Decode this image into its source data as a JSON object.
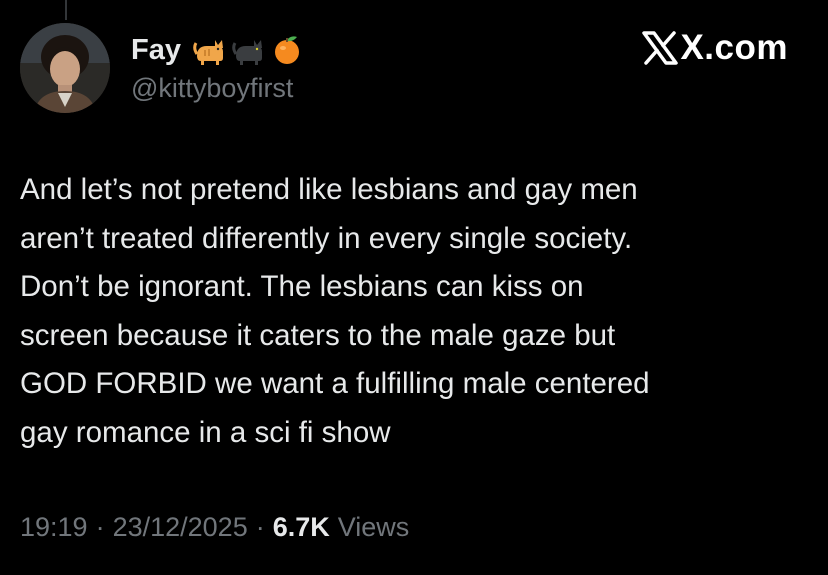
{
  "colors": {
    "background": "#000000",
    "primary_text": "#e7e9ea",
    "secondary_text": "#71767b"
  },
  "author": {
    "display_name": "Fay",
    "handle": "@kittyboyfirst",
    "name_emojis": [
      "orange-cat-emoji",
      "black-cat-emoji",
      "tangerine-emoji"
    ]
  },
  "brand": {
    "label": "X.com",
    "logo_icon": "x-logo-icon"
  },
  "tweet": {
    "lines": [
      "And let’s not pretend like lesbians and gay men",
      "aren’t treated differently in every single society.",
      "Don’t be ignorant. The lesbians can kiss on",
      "screen because it caters to the male gaze but",
      "GOD FORBID we want a fulfilling male centered",
      "gay romance in a sci fi show"
    ]
  },
  "meta": {
    "time": "19:19",
    "separator": "·",
    "date": "23/12/2025",
    "views_count": "6.7K",
    "views_label": "Views"
  }
}
